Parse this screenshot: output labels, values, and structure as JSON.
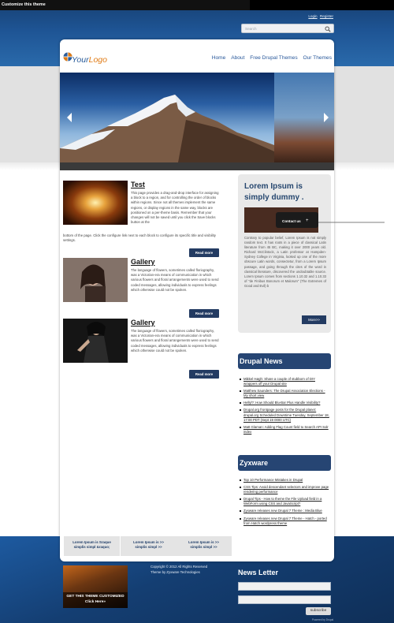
{
  "admin_bar": {
    "title": "Customize this theme"
  },
  "top_links": {
    "login": "Login",
    "register": "Register"
  },
  "search": {
    "placeholder": "Search"
  },
  "logo": {
    "your": "Your",
    "logo": "Logo"
  },
  "nav": [
    "Home",
    "About",
    "Free Drupal Themes",
    "Our Themes"
  ],
  "articles": [
    {
      "title": "Test",
      "body": "This page provides a drag-and-drop interface for assigning a block to a region, and for controlling the order of blocks within regions. Since not all themes implement the same regions, or display regions in the same way, blocks are positioned on a per-theme basis. Remember that your changes will not be saved until you click the Save blocks button at the",
      "body_continued": "bottom of the page. Click the configure link next to each block to configure its specific title and visibility settings.",
      "read_more": "Read more"
    },
    {
      "title": "Gallery",
      "body": "The language of flowers, sometimes called floriography, was a Victorian-era means of communication in which various flowers and floral arrangements were used to send coded messages, allowing individuals to express feelings which otherwise could not be spoken.",
      "read_more": "Read more"
    },
    {
      "title": "Gallery",
      "body": "The language of flowers, sometimes called floriography, was a Victorian-era means of communication in which various flowers and floral arrangements were used to send coded messages, allowing individuals to express feelings which otherwise could not be spoken.",
      "read_more": "Read more"
    }
  ],
  "lorem_box": {
    "title": "Lorem Ipsum is simply dummy .",
    "contact": "Contact us",
    "body": "Contrary to popular belief, Lorem Ipsum is not simply random text. It has roots in a piece of classical Latin literature from 45 BC, making it over 2000 years old. Richard McClintock, a Latin professor at Hampden-Sydney College in Virginia, looked up one of the more obscure Latin words, consectetur, from a Lorem Ipsum passage, and going through the cites of the word in classical literature, discovered the undoubtable source. Lorem Ipsum comes from sections 1.10.32 and 1.10.33 of \"de Finibus Bonorum et Malorum\" (The Extremes of Good and Evil) b",
    "more": "More>>"
  },
  "drupal_news": {
    "title": "Drupal News",
    "items": [
      "Mikkel Høgh: Share a couple of stubborn of DIY wrappers off your Drupal site",
      "Matthew Saunders: The Drupal Association Elections - My short view",
      "Hellyl?: How Should Blu-Bar Plus Handle Visibility?",
      "Drupal.org frontpage posts for the Drupal planet: drupal.org Scheduled Downtime Tuesday, September 18, 17:00 PDT (Sept 19 0000 UTC)",
      "Matt Glaman: Adding Flag Count field to Search API Solr index"
    ]
  },
  "zyxware": {
    "title": "Zyxware",
    "items": [
      "Top 10 Performance Mistakes in Drupal",
      "CSS Tips: Avoid descendant selectors and improve page rendering performance",
      "Drupal Tips - How to theme the File Upload field in a WebForm using CSS and JavaScript?",
      "Zyxware releases new Drupal 7 Theme : Media Blue",
      "Zyxware releases new Drupal 7 Theme - Hatch - ported from Hatch wordpress theme"
    ]
  },
  "bottom_columns": [
    {
      "line1": "Lorem Ipsum is Sraque",
      "line2": "simplis simpl &raquo;"
    },
    {
      "line1": "Lorem Ipsum is >>",
      "line2": "simplis simpl >>"
    },
    {
      "line1": "Lorem Ipsum is >>",
      "line2": "simplis simpl >>"
    }
  ],
  "footer": {
    "promo_line1": "GET THIS THEME CUSTOMIZED",
    "promo_line2": "Click Here»",
    "copyright_line1": "Copyright © 2012 All Rights Reserved",
    "copyright_line2": "Theme by Zyxware Technologies",
    "newsletter_title": "News Letter",
    "subscribe": "subscribe",
    "powered_by": "Powered by Drupal"
  },
  "colors": {
    "header_blue": "#1e5494",
    "nav_blue": "#27579a",
    "button_navy": "#233b62",
    "block_title": "#264573",
    "logo_orange": "#e07a13"
  }
}
